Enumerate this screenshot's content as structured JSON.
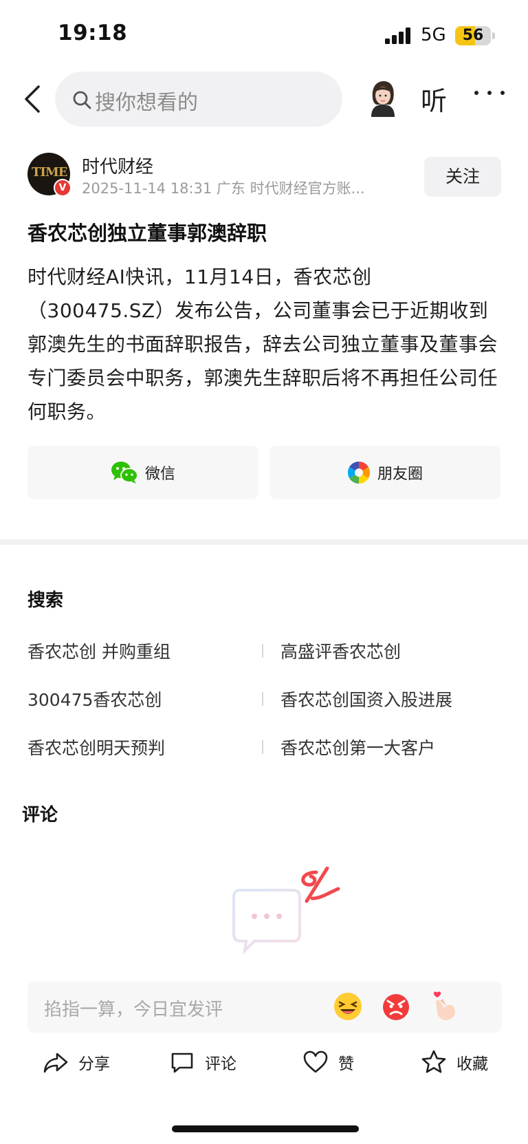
{
  "status_bar": {
    "time": "19:18",
    "network": "5G",
    "battery": "56",
    "battery_level": 0.56
  },
  "search": {
    "placeholder": "搜你想看的"
  },
  "header": {
    "listen_label": "听"
  },
  "author": {
    "logo_text": "TIME",
    "verified_badge": "V",
    "name": "时代财经",
    "meta": "2025-11-14  18:31  广东  时代财经官方账...",
    "follow_label": "关注"
  },
  "article": {
    "title": "香农芯创独立董事郭澳辞职",
    "body": "时代财经AI快讯，11月14日，香农芯创（300475.SZ）发布公告，公司董事会已于近期收到郭澳先生的书面辞职报告，辞去公司独立董事及董事会专门委员会中职务，郭澳先生辞职后将不再担任公司任何职务。"
  },
  "share": {
    "wechat_label": "微信",
    "moments_label": "朋友圈"
  },
  "search_suggestions": {
    "heading": "搜索",
    "items": [
      "香农芯创 并购重组",
      "高盛评香农芯创",
      "300475香农芯创",
      "香农芯创国资入股进展",
      "香农芯创明天预判",
      "香农芯创第一大客户"
    ]
  },
  "comments": {
    "heading": "评论",
    "input_placeholder": "掐指一算，今日宜发评"
  },
  "emojis": [
    "laughing-emoji",
    "angry-emoji",
    "finger-heart-emoji"
  ],
  "action_bar": {
    "share": "分享",
    "comment": "评论",
    "like": "赞",
    "favorite": "收藏"
  },
  "colors": {
    "accent_red": "#e53935",
    "wechat_green": "#2dc100",
    "battery_yellow": "#f6c514"
  }
}
